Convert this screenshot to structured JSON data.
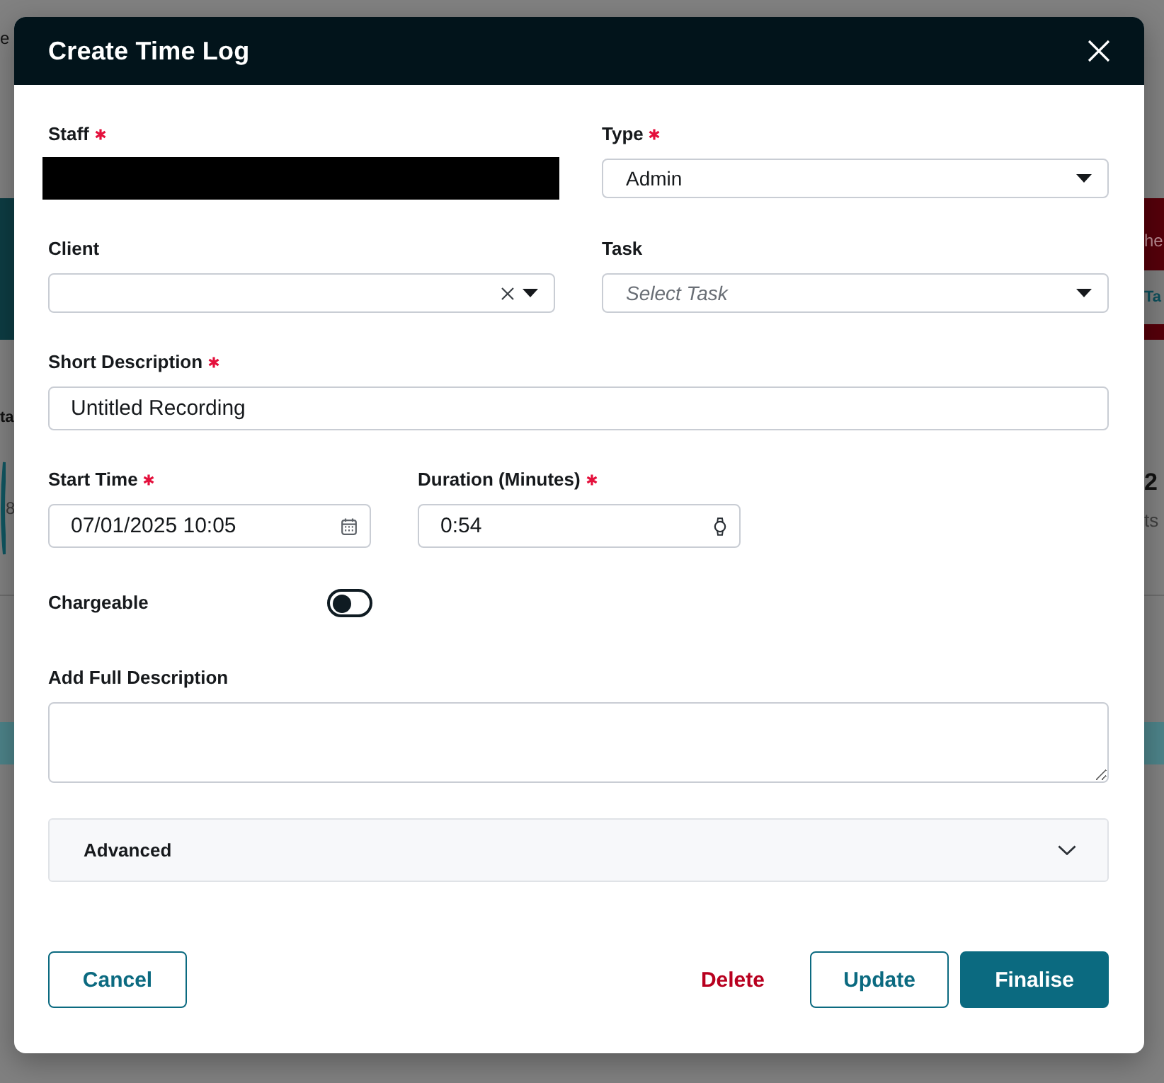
{
  "background_page": {
    "left_edge": [
      {
        "kind": "nav",
        "text": "e"
      },
      {
        "kind": "heading",
        "text": "ta"
      },
      {
        "kind": "number",
        "text": "8"
      }
    ],
    "right_edge": [
      {
        "kind": "banner",
        "text": "he"
      },
      {
        "kind": "pill",
        "text": "Ta"
      },
      {
        "kind": "number",
        "text": "2"
      },
      {
        "kind": "caption",
        "text": "ts"
      }
    ]
  },
  "dialog": {
    "title": "Create Time Log",
    "rows": [
      {
        "fields": [
          {
            "kind": "redacted",
            "label": "Staff",
            "required": true
          },
          {
            "kind": "select",
            "label": "Type",
            "required": true,
            "value": "Admin",
            "clearable": false
          }
        ]
      },
      {
        "fields": [
          {
            "kind": "select",
            "label": "Client",
            "required": false,
            "clearable": true
          },
          {
            "kind": "select",
            "label": "Task",
            "required": false,
            "placeholder": "Select Task",
            "clearable": false
          }
        ]
      },
      {
        "fields": [
          {
            "kind": "text",
            "label": "Short Description",
            "required": true,
            "value": "Untitled Recording"
          }
        ]
      },
      {
        "fields": [
          {
            "kind": "date",
            "label": "Start Time",
            "required": true,
            "value": "07/01/2025 10:05"
          },
          {
            "kind": "duration",
            "label": "Duration (Minutes)",
            "required": true,
            "value": "0:54"
          }
        ]
      },
      {
        "fields": [
          {
            "kind": "toggle",
            "label": "Chargeable",
            "on": false
          }
        ]
      },
      {
        "fields": [
          {
            "kind": "textarea",
            "label": "Add Full Description",
            "required": false
          }
        ]
      }
    ],
    "advanced": {
      "label": "Advanced",
      "expanded": false
    },
    "footer": {
      "left": [
        {
          "label": "Cancel",
          "kind": "secondary"
        }
      ],
      "right": [
        {
          "label": "Delete",
          "kind": "danger"
        },
        {
          "label": "Update",
          "kind": "secondary"
        },
        {
          "label": "Finalise",
          "kind": "primary"
        }
      ]
    }
  }
}
